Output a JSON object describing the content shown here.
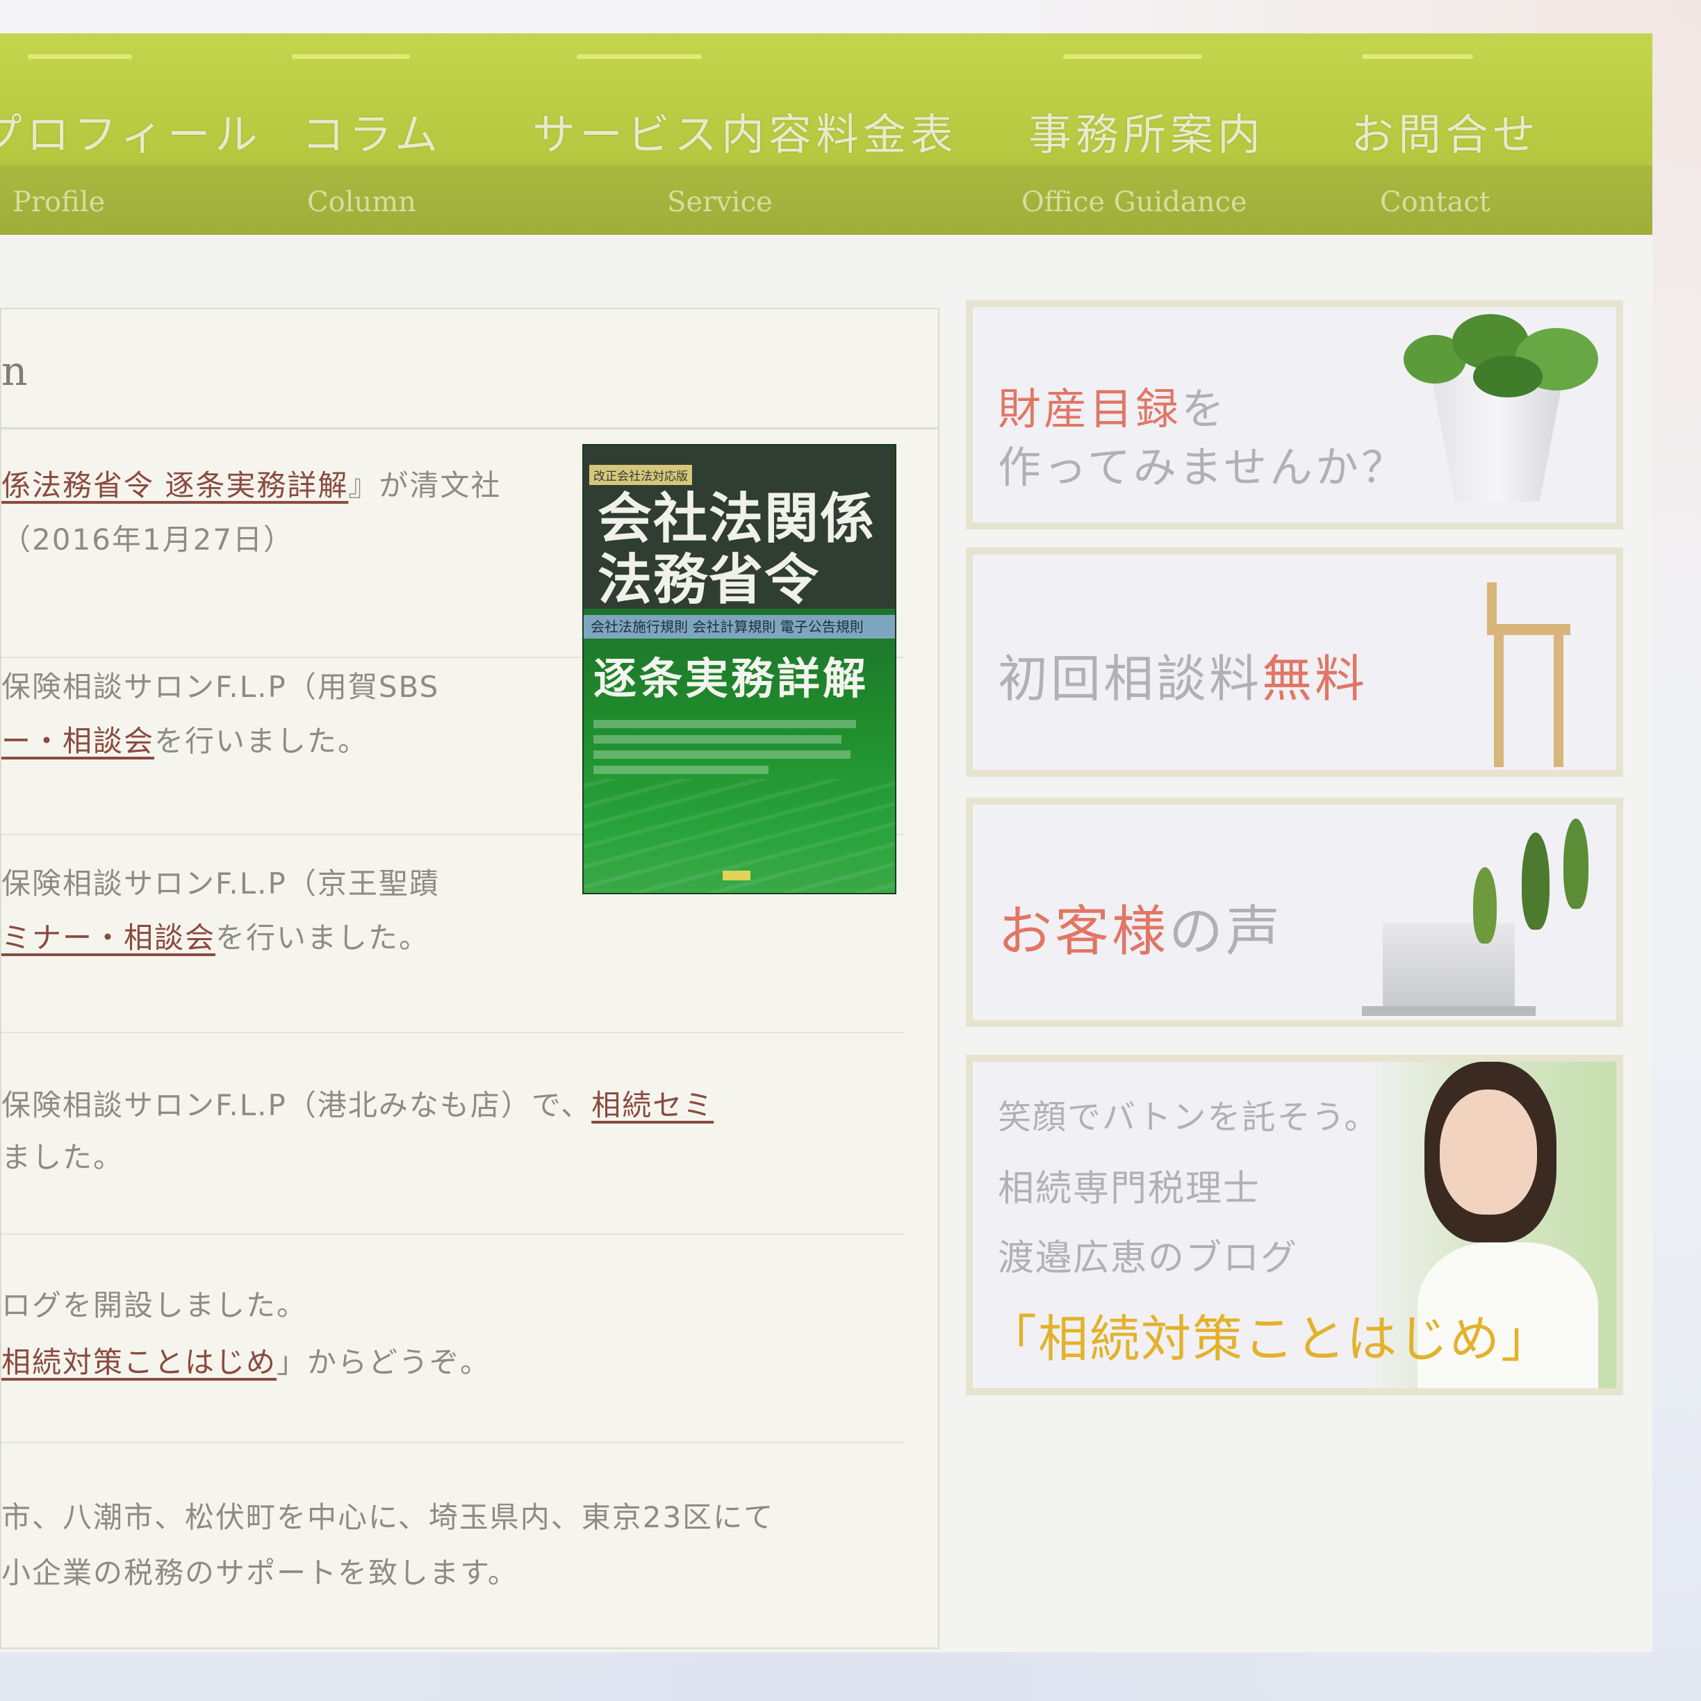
{
  "nav": {
    "items": [
      {
        "jp": "プロフィール",
        "en": "Profile"
      },
      {
        "jp": "コラム",
        "en": "Column"
      },
      {
        "jp": "サービス内容料金表",
        "en": "Service"
      },
      {
        "jp": "事務所案内",
        "en": "Office Guidance"
      },
      {
        "jp": "お問合せ",
        "en": "Contact"
      }
    ]
  },
  "main": {
    "title_fragment": "n",
    "news": [
      {
        "line1_link": "係法務省令 逐条実務詳解",
        "line1_rest": "』が清文社",
        "line2": "（2016年1月27日）"
      },
      {
        "line1": "保険相談サロンF.L.P（用賀SBS",
        "line2_link": "ー・相談会",
        "line2_rest": "を行いました。"
      },
      {
        "line1": "保険相談サロンF.L.P（京王聖蹟",
        "line2_link": "ミナー・相談会",
        "line2_rest": "を行いました。"
      },
      {
        "line1_prefix": "保険相談サロンF.L.P（港北みなも店）で、",
        "line1_link": "相続セミ",
        "line2": "ました。"
      },
      {
        "line1": "ログを開設しました。",
        "line2_link": "相続対策ことはじめ",
        "line2_rest": "」からどうぞ。"
      },
      {
        "line1": "市、八潮市、松伏町を中心に、埼玉県内、東京23区にて",
        "line2": "小企業の税務のサポートを致します。"
      }
    ],
    "book": {
      "tag": "改正会社法対応版",
      "title": "会社法関係法務省令",
      "strip": "会社法施行規則 会社計算規則 電子公告規則",
      "subtitle": "逐条実務詳解"
    }
  },
  "sidebar": {
    "banner1": {
      "accent": "財産目録",
      "rest": "を",
      "line2": "作ってみませんか？"
    },
    "banner2": {
      "plain": "初回相談料",
      "accent": "無料"
    },
    "banner3": {
      "accent": "お客様",
      "rest": "の声"
    },
    "banner4": {
      "line1": "笑顔でバトンを託そう。",
      "line2": "相続専門税理士",
      "line3": "渡邉広恵のブログ",
      "line4": "「相続対策ことはじめ」"
    }
  },
  "colors": {
    "nav_green": "#b4c93f",
    "link": "#8b4a3f",
    "accent_red": "#e07665",
    "accent_yellow": "#e3b22a"
  }
}
